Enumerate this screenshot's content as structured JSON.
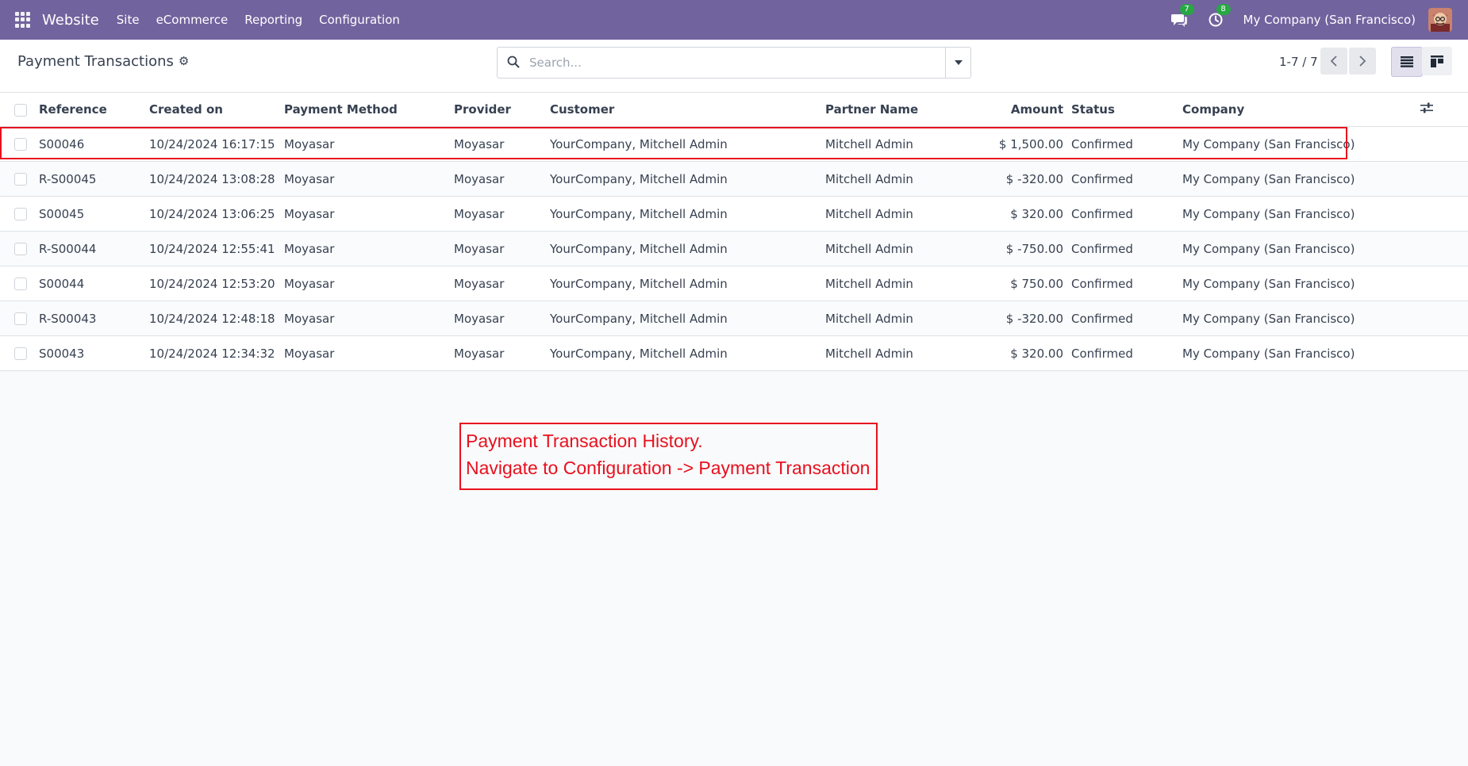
{
  "navbar": {
    "brand": "Website",
    "menus": [
      "Site",
      "eCommerce",
      "Reporting",
      "Configuration"
    ],
    "messages_count": "7",
    "activities_count": "8",
    "company": "My Company (San Francisco)"
  },
  "control_panel": {
    "title": "Payment Transactions",
    "search_placeholder": "Search...",
    "pager": "1-7 / 7"
  },
  "table": {
    "columns": [
      "Reference",
      "Created on",
      "Payment Method",
      "Provider",
      "Customer",
      "Partner Name",
      "Amount",
      "Status",
      "Company"
    ],
    "rows": [
      {
        "reference": "S00046",
        "created_on": "10/24/2024 16:17:15",
        "payment_method": "Moyasar",
        "provider": "Moyasar",
        "customer": "YourCompany, Mitchell Admin",
        "partner_name": "Mitchell Admin",
        "amount": "$ 1,500.00",
        "status": "Confirmed",
        "company": "My Company (San Francisco)"
      },
      {
        "reference": "R-S00045",
        "created_on": "10/24/2024 13:08:28",
        "payment_method": "Moyasar",
        "provider": "Moyasar",
        "customer": "YourCompany, Mitchell Admin",
        "partner_name": "Mitchell Admin",
        "amount": "$ -320.00",
        "status": "Confirmed",
        "company": "My Company (San Francisco)"
      },
      {
        "reference": "S00045",
        "created_on": "10/24/2024 13:06:25",
        "payment_method": "Moyasar",
        "provider": "Moyasar",
        "customer": "YourCompany, Mitchell Admin",
        "partner_name": "Mitchell Admin",
        "amount": "$ 320.00",
        "status": "Confirmed",
        "company": "My Company (San Francisco)"
      },
      {
        "reference": "R-S00044",
        "created_on": "10/24/2024 12:55:41",
        "payment_method": "Moyasar",
        "provider": "Moyasar",
        "customer": "YourCompany, Mitchell Admin",
        "partner_name": "Mitchell Admin",
        "amount": "$ -750.00",
        "status": "Confirmed",
        "company": "My Company (San Francisco)"
      },
      {
        "reference": "S00044",
        "created_on": "10/24/2024 12:53:20",
        "payment_method": "Moyasar",
        "provider": "Moyasar",
        "customer": "YourCompany, Mitchell Admin",
        "partner_name": "Mitchell Admin",
        "amount": "$ 750.00",
        "status": "Confirmed",
        "company": "My Company (San Francisco)"
      },
      {
        "reference": "R-S00043",
        "created_on": "10/24/2024 12:48:18",
        "payment_method": "Moyasar",
        "provider": "Moyasar",
        "customer": "YourCompany, Mitchell Admin",
        "partner_name": "Mitchell Admin",
        "amount": "$ -320.00",
        "status": "Confirmed",
        "company": "My Company (San Francisco)"
      },
      {
        "reference": "S00043",
        "created_on": "10/24/2024 12:34:32",
        "payment_method": "Moyasar",
        "provider": "Moyasar",
        "customer": "YourCompany, Mitchell Admin",
        "partner_name": "Mitchell Admin",
        "amount": "$ 320.00",
        "status": "Confirmed",
        "company": "My Company (San Francisco)"
      }
    ]
  },
  "annotation": {
    "line1": "Payment Transaction History.",
    "line2": "Navigate to Configuration -> Payment Transaction"
  },
  "colors": {
    "navbar": "#71639e",
    "annotation": "#e8101e",
    "badge": "#28a745"
  }
}
